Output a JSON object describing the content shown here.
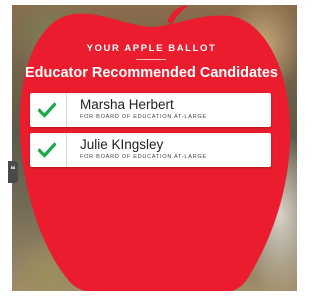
{
  "ballot": {
    "eyebrow": "YOUR APPLE BALLOT",
    "heading": "Educator Recommended Candidates",
    "candidates": [
      {
        "name": "Marsha Herbert",
        "office": "FOR BOARD OF EDUCATION AT-LARGE",
        "endorsed": true
      },
      {
        "name": "Julie KIngsley",
        "office": "FOR BOARD OF EDUCATION AT-LARGE",
        "endorsed": true
      }
    ]
  },
  "colors": {
    "apple_red": "#ea1c2d",
    "check_green": "#1fa84a",
    "card_white": "#ffffff"
  },
  "icons": {
    "check": "check-icon",
    "side_tab": "quote-icon"
  }
}
